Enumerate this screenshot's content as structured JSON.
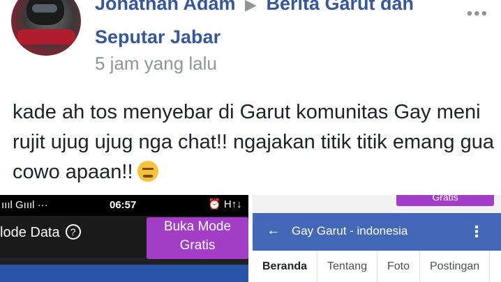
{
  "post": {
    "author": "Jonathan Adam",
    "group": "Berita Garut dan Seputar Jabar",
    "time": "5 jam yang lalu",
    "more_icon": "•••",
    "arrow_icon": "▶",
    "text": "kade ah tos menyebar di Garut komunitas Gay meni rujit ujug ujug nga chat!! ngajakan titik titik emang gua cowo apaan!!",
    "emoji": "angry-face-emoji"
  },
  "left_screenshot": {
    "signal": "ıııl Gıııl ···",
    "clock": "06:57",
    "status_right": "⏰ H↑↓",
    "mode_label": "lode Data",
    "help_icon": "?",
    "button_label": "Buka Mode Gratis"
  },
  "right_screenshot": {
    "gratis_label": "Gratis",
    "back_icon": "←",
    "page_title": "Gay Garut - indonesia",
    "menu_icon": "⋮",
    "tabs": [
      "Beranda",
      "Tentang",
      "Foto",
      "Postingan"
    ]
  },
  "colors": {
    "link": "#365899",
    "meta": "#90949c",
    "purple_button": "#a23ec6",
    "fb_blue": "#4468b8"
  }
}
